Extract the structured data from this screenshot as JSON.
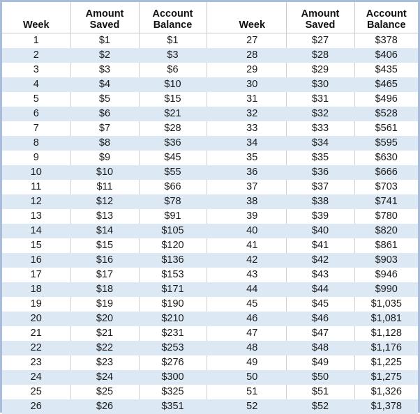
{
  "table": {
    "headers_left": [
      "Week",
      "Amount Saved",
      "Account Balance"
    ],
    "headers_right": [
      "Week",
      "Amount Saved",
      "Account Balance"
    ],
    "header_lines": {
      "week": [
        "",
        "Week"
      ],
      "amount_saved": [
        "Amount",
        "Saved"
      ],
      "account_balance": [
        "Account",
        "Balance"
      ]
    },
    "colors": {
      "band": "#dce8f4",
      "outer_border": "#a9bcd9",
      "gridline": "#d0d0d0",
      "header_rule": "#c9c9c9",
      "text": "#1a1a1a"
    },
    "rows": [
      {
        "week_l": "1",
        "saved_l": "$1",
        "bal_l": "$1",
        "week_r": "27",
        "saved_r": "$27",
        "bal_r": "$378"
      },
      {
        "week_l": "2",
        "saved_l": "$2",
        "bal_l": "$3",
        "week_r": "28",
        "saved_r": "$28",
        "bal_r": "$406"
      },
      {
        "week_l": "3",
        "saved_l": "$3",
        "bal_l": "$6",
        "week_r": "29",
        "saved_r": "$29",
        "bal_r": "$435"
      },
      {
        "week_l": "4",
        "saved_l": "$4",
        "bal_l": "$10",
        "week_r": "30",
        "saved_r": "$30",
        "bal_r": "$465"
      },
      {
        "week_l": "5",
        "saved_l": "$5",
        "bal_l": "$15",
        "week_r": "31",
        "saved_r": "$31",
        "bal_r": "$496"
      },
      {
        "week_l": "6",
        "saved_l": "$6",
        "bal_l": "$21",
        "week_r": "32",
        "saved_r": "$32",
        "bal_r": "$528"
      },
      {
        "week_l": "7",
        "saved_l": "$7",
        "bal_l": "$28",
        "week_r": "33",
        "saved_r": "$33",
        "bal_r": "$561"
      },
      {
        "week_l": "8",
        "saved_l": "$8",
        "bal_l": "$36",
        "week_r": "34",
        "saved_r": "$34",
        "bal_r": "$595"
      },
      {
        "week_l": "9",
        "saved_l": "$9",
        "bal_l": "$45",
        "week_r": "35",
        "saved_r": "$35",
        "bal_r": "$630"
      },
      {
        "week_l": "10",
        "saved_l": "$10",
        "bal_l": "$55",
        "week_r": "36",
        "saved_r": "$36",
        "bal_r": "$666"
      },
      {
        "week_l": "11",
        "saved_l": "$11",
        "bal_l": "$66",
        "week_r": "37",
        "saved_r": "$37",
        "bal_r": "$703"
      },
      {
        "week_l": "12",
        "saved_l": "$12",
        "bal_l": "$78",
        "week_r": "38",
        "saved_r": "$38",
        "bal_r": "$741"
      },
      {
        "week_l": "13",
        "saved_l": "$13",
        "bal_l": "$91",
        "week_r": "39",
        "saved_r": "$39",
        "bal_r": "$780"
      },
      {
        "week_l": "14",
        "saved_l": "$14",
        "bal_l": "$105",
        "week_r": "40",
        "saved_r": "$40",
        "bal_r": "$820"
      },
      {
        "week_l": "15",
        "saved_l": "$15",
        "bal_l": "$120",
        "week_r": "41",
        "saved_r": "$41",
        "bal_r": "$861"
      },
      {
        "week_l": "16",
        "saved_l": "$16",
        "bal_l": "$136",
        "week_r": "42",
        "saved_r": "$42",
        "bal_r": "$903"
      },
      {
        "week_l": "17",
        "saved_l": "$17",
        "bal_l": "$153",
        "week_r": "43",
        "saved_r": "$43",
        "bal_r": "$946"
      },
      {
        "week_l": "18",
        "saved_l": "$18",
        "bal_l": "$171",
        "week_r": "44",
        "saved_r": "$44",
        "bal_r": "$990"
      },
      {
        "week_l": "19",
        "saved_l": "$19",
        "bal_l": "$190",
        "week_r": "45",
        "saved_r": "$45",
        "bal_r": "$1,035"
      },
      {
        "week_l": "20",
        "saved_l": "$20",
        "bal_l": "$210",
        "week_r": "46",
        "saved_r": "$46",
        "bal_r": "$1,081"
      },
      {
        "week_l": "21",
        "saved_l": "$21",
        "bal_l": "$231",
        "week_r": "47",
        "saved_r": "$47",
        "bal_r": "$1,128"
      },
      {
        "week_l": "22",
        "saved_l": "$22",
        "bal_l": "$253",
        "week_r": "48",
        "saved_r": "$48",
        "bal_r": "$1,176"
      },
      {
        "week_l": "23",
        "saved_l": "$23",
        "bal_l": "$276",
        "week_r": "49",
        "saved_r": "$49",
        "bal_r": "$1,225"
      },
      {
        "week_l": "24",
        "saved_l": "$24",
        "bal_l": "$300",
        "week_r": "50",
        "saved_r": "$50",
        "bal_r": "$1,275"
      },
      {
        "week_l": "25",
        "saved_l": "$25",
        "bal_l": "$325",
        "week_r": "51",
        "saved_r": "$51",
        "bal_r": "$1,326"
      },
      {
        "week_l": "26",
        "saved_l": "$26",
        "bal_l": "$351",
        "week_r": "52",
        "saved_r": "$52",
        "bal_r": "$1,378"
      }
    ]
  }
}
